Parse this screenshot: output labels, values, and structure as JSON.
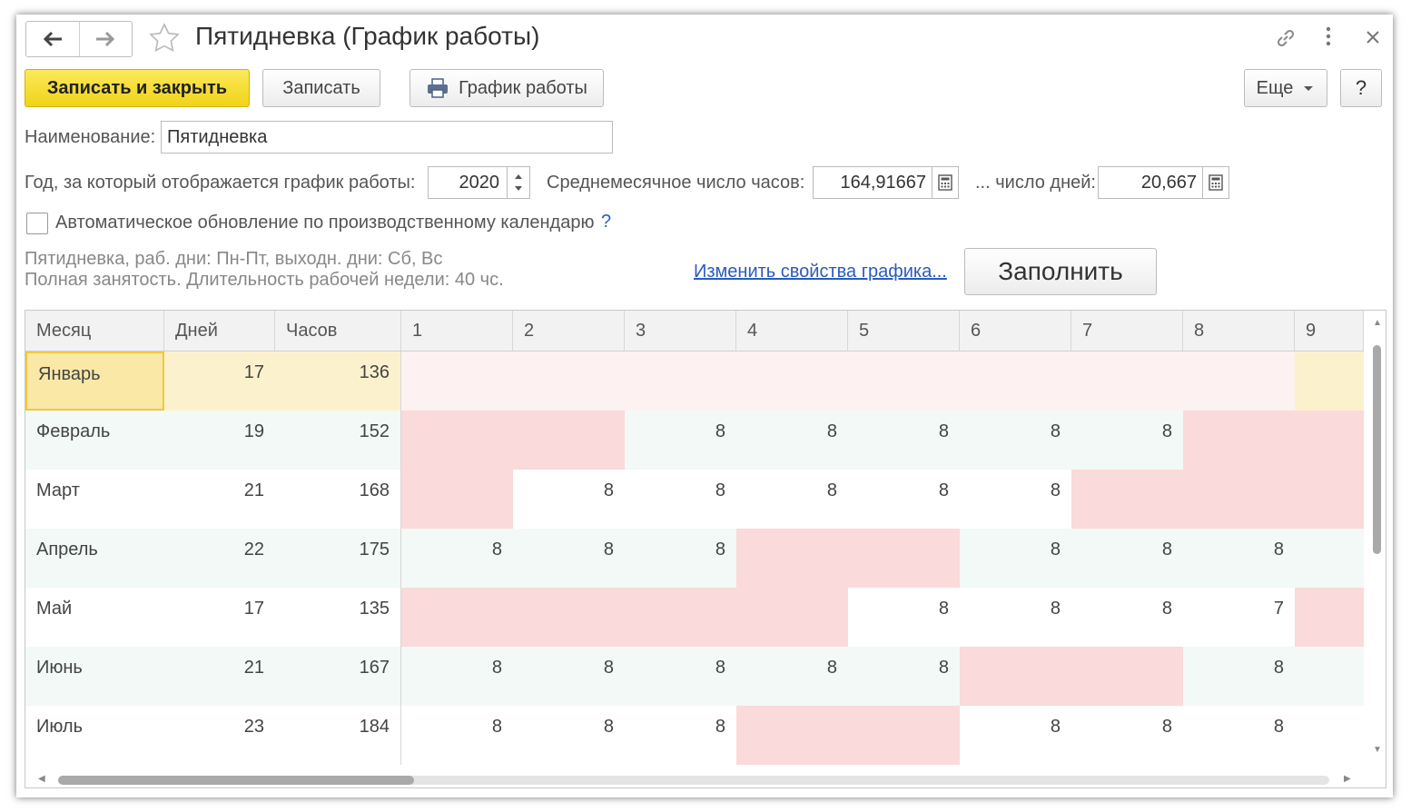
{
  "window": {
    "title": "Пятидневка (График работы)"
  },
  "toolbar": {
    "save_close_label": "Записать и закрыть",
    "save_label": "Записать",
    "schedule_label": "График работы",
    "more_label": "Еще",
    "help_label": "?"
  },
  "form": {
    "name_label": "Наименование:",
    "name_value": "Пятидневка",
    "year_label": "Год, за который отображается график работы:",
    "year_value": "2020",
    "avg_hours_label": "Среднемесячное число часов:",
    "avg_hours_value": "164,91667",
    "avg_days_label": "... число дней:",
    "avg_days_value": "20,667",
    "auto_update_label": "Автоматическое обновление по производственному календарю",
    "auto_update_checked": false,
    "help_mark": "?",
    "description_line1": "Пятидневка, раб. дни: Пн-Пт, выходн. дни: Сб, Вс",
    "description_line2": "Полная занятость. Длительность рабочей недели: 40 чс.",
    "change_props_link": "Изменить свойства графика...",
    "fill_label": "Заполнить"
  },
  "table": {
    "headers": [
      "Месяц",
      "Дней",
      "Часов",
      "1",
      "2",
      "3",
      "4",
      "5",
      "6",
      "7",
      "8",
      "9"
    ],
    "rows": [
      {
        "month": "Январь",
        "days": "17",
        "hours": "136",
        "cells": [
          "",
          "",
          "",
          "",
          "",
          "",
          "",
          "",
          ""
        ]
      },
      {
        "month": "Февраль",
        "days": "19",
        "hours": "152",
        "cells": [
          "",
          "",
          "8",
          "8",
          "8",
          "8",
          "8",
          "",
          ""
        ]
      },
      {
        "month": "Март",
        "days": "21",
        "hours": "168",
        "cells": [
          "",
          "8",
          "8",
          "8",
          "8",
          "8",
          "",
          "",
          ""
        ]
      },
      {
        "month": "Апрель",
        "days": "22",
        "hours": "175",
        "cells": [
          "8",
          "8",
          "8",
          "",
          "",
          "8",
          "8",
          "8",
          ""
        ]
      },
      {
        "month": "Май",
        "days": "17",
        "hours": "135",
        "cells": [
          "",
          "",
          "",
          "",
          "8",
          "8",
          "8",
          "7",
          ""
        ]
      },
      {
        "month": "Июнь",
        "days": "21",
        "hours": "167",
        "cells": [
          "8",
          "8",
          "8",
          "8",
          "8",
          "",
          "",
          "8",
          ""
        ]
      },
      {
        "month": "Июль",
        "days": "23",
        "hours": "184",
        "cells": [
          "8",
          "8",
          "8",
          "",
          "",
          "8",
          "8",
          "8",
          ""
        ]
      }
    ]
  },
  "colors": {
    "primary_button": "#f5dd2f",
    "holiday_cell": "#fadada",
    "alt_row": "#f2f9f7",
    "link": "#2a5bbd"
  }
}
